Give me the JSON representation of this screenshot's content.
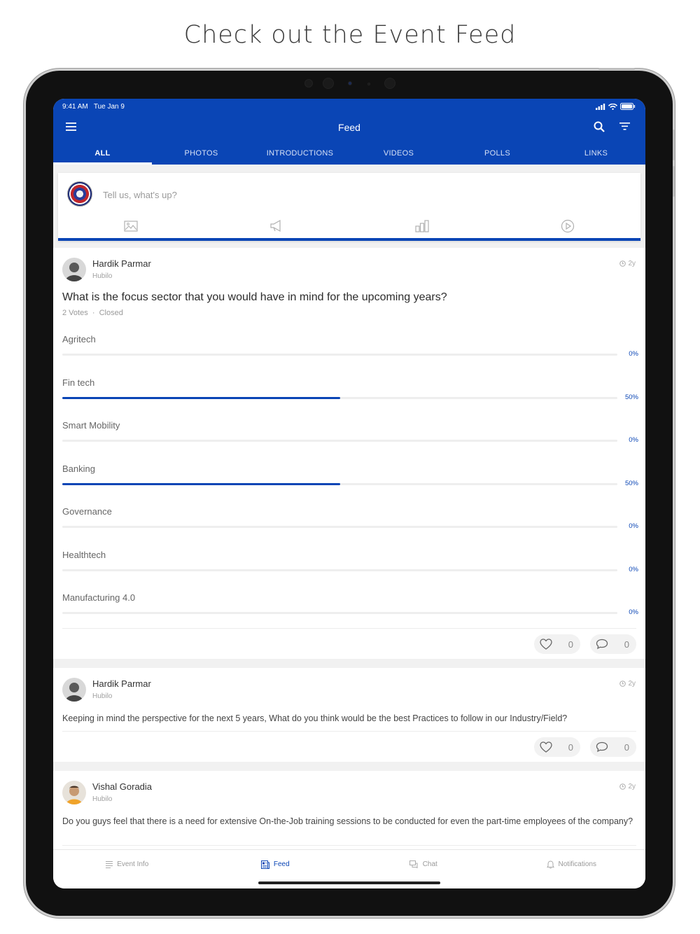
{
  "headline": "Check out the Event Feed",
  "status": {
    "time": "9:41 AM",
    "date": "Tue Jan 9"
  },
  "appbar": {
    "title": "Feed"
  },
  "tabs": [
    {
      "label": "ALL",
      "active": true
    },
    {
      "label": "PHOTOS",
      "active": false
    },
    {
      "label": "INTRODUCTIONS",
      "active": false
    },
    {
      "label": "VIDEOS",
      "active": false
    },
    {
      "label": "POLLS",
      "active": false
    },
    {
      "label": "LINKS",
      "active": false
    }
  ],
  "composer": {
    "placeholder": "Tell us, what's up?"
  },
  "posts": [
    {
      "author": "Hardik Parmar",
      "org": "Hubilo",
      "time": "2y",
      "question": "What is the focus sector that you would have in mind for the upcoming years?",
      "votes": "2 Votes",
      "status": "Closed",
      "options": [
        {
          "label": "Agritech",
          "pct": "0%",
          "value": 0
        },
        {
          "label": "Fin tech",
          "pct": "50%",
          "value": 50
        },
        {
          "label": "Smart Mobility",
          "pct": "0%",
          "value": 0
        },
        {
          "label": "Banking",
          "pct": "50%",
          "value": 50
        },
        {
          "label": "Governance",
          "pct": "0%",
          "value": 0
        },
        {
          "label": "Healthtech",
          "pct": "0%",
          "value": 0
        },
        {
          "label": "Manufacturing 4.0",
          "pct": "0%",
          "value": 0
        }
      ],
      "likes": "0",
      "comments": "0"
    },
    {
      "author": "Hardik Parmar",
      "org": "Hubilo",
      "time": "2y",
      "text": "Keeping in mind the perspective for the next 5 years, What do you think would be the best Practices to follow in our Industry/Field?",
      "likes": "0",
      "comments": "0"
    },
    {
      "author": "Vishal Goradia",
      "org": "Hubilo",
      "time": "2y",
      "text": "Do you guys feel that there is a need for extensive On-the-Job training sessions to be conducted for even the part-time employees of the company?"
    }
  ],
  "bottom_nav": [
    {
      "label": "Event Info",
      "active": false
    },
    {
      "label": "Feed",
      "active": true
    },
    {
      "label": "Chat",
      "active": false
    },
    {
      "label": "Notifications",
      "active": false
    }
  ],
  "colors": {
    "primary": "#0a45b5",
    "bar_track": "#eeeeee"
  }
}
